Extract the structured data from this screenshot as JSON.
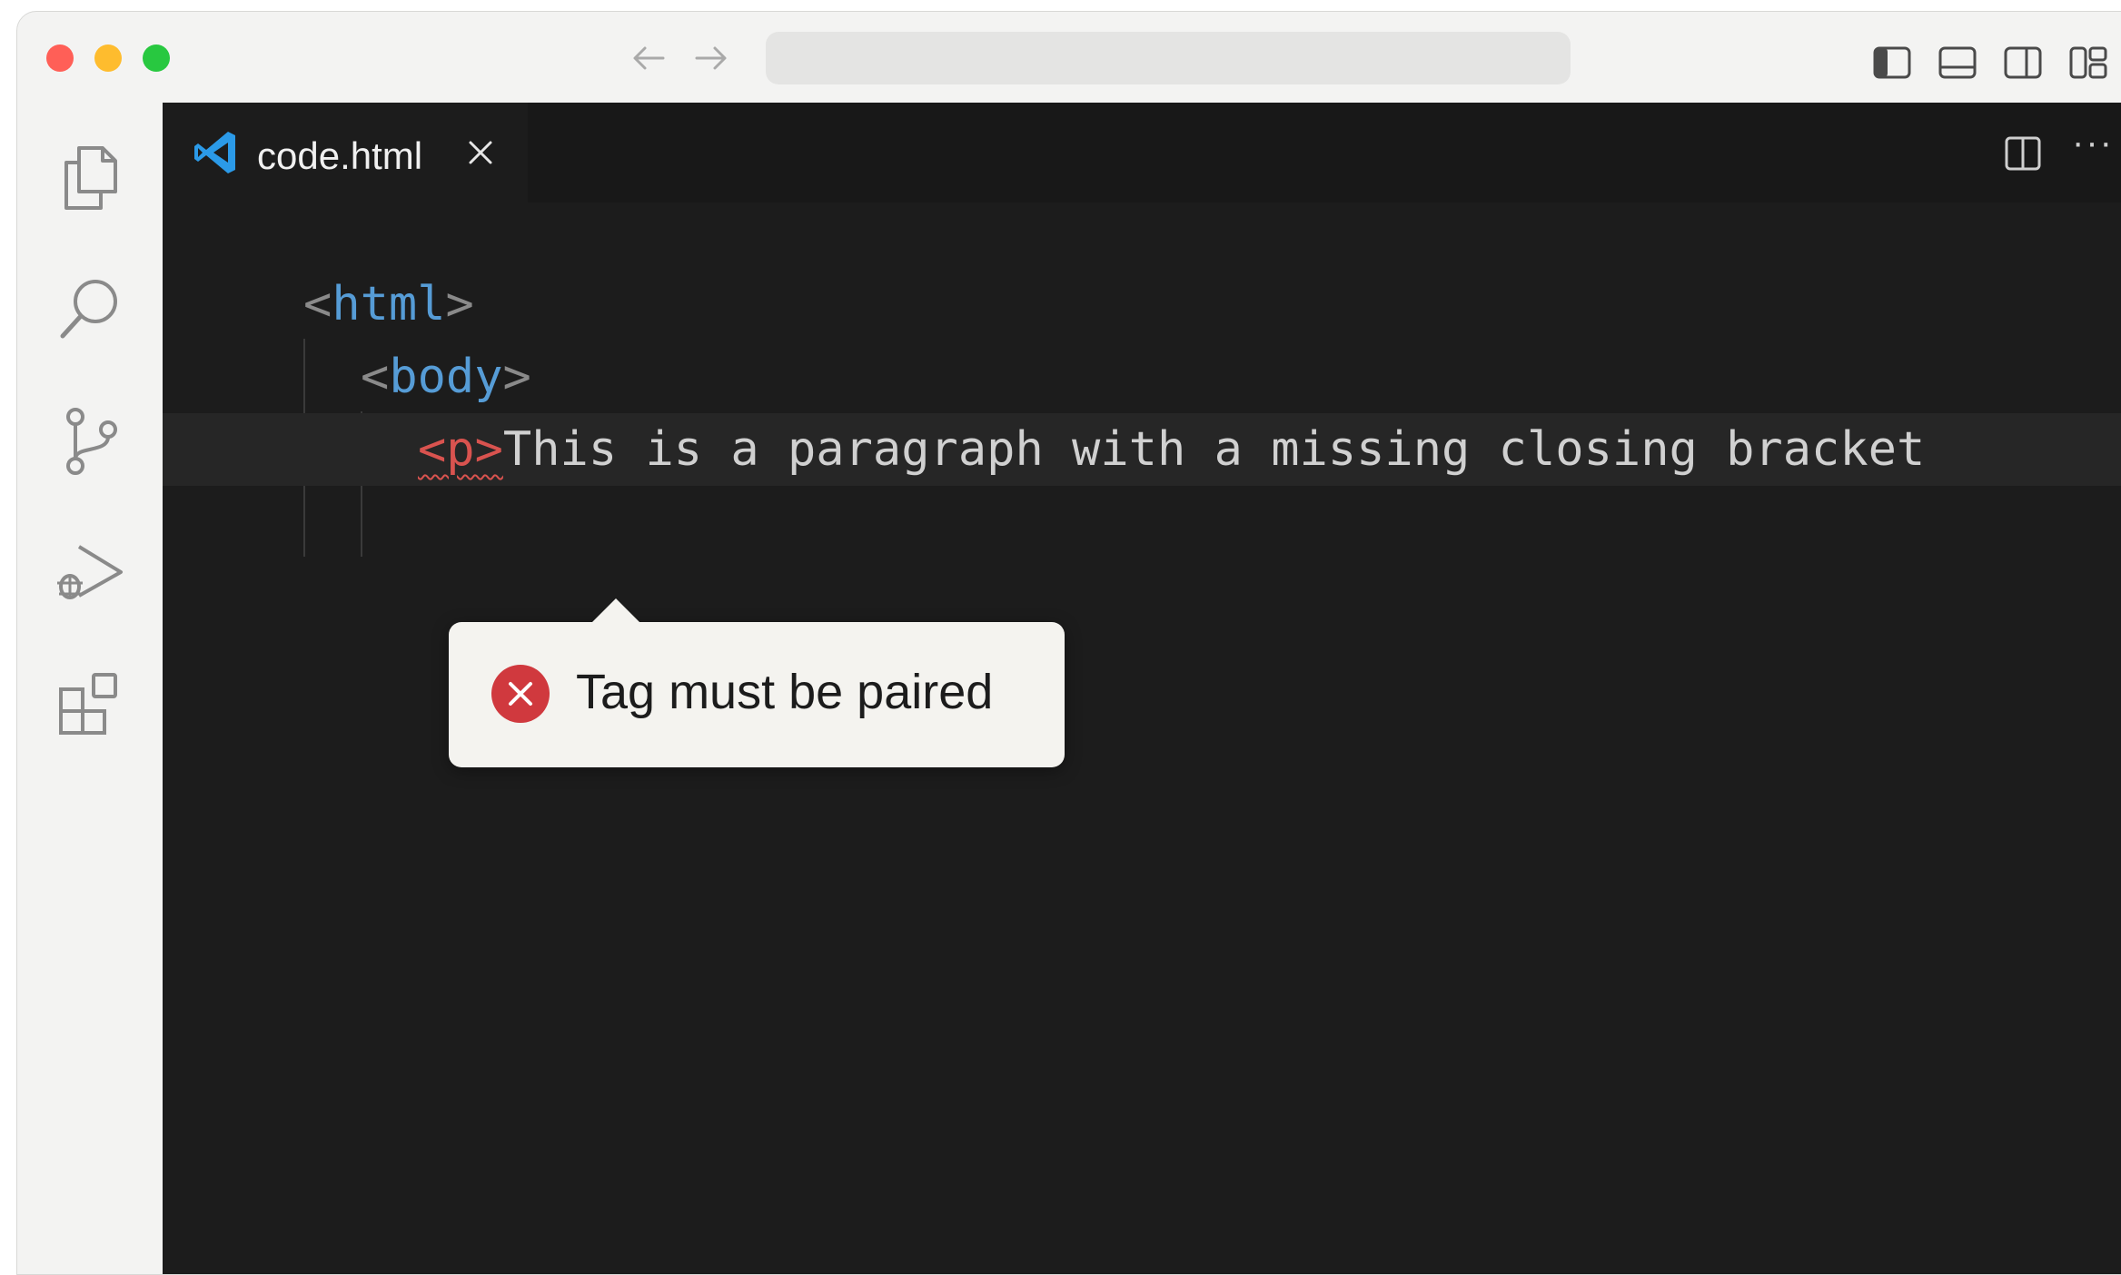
{
  "window": {
    "traffic_lights": {
      "close": "#ff5f57",
      "minimize": "#febc2e",
      "maximize": "#28c840"
    },
    "nav": {
      "back_icon": "arrow-left-icon",
      "forward_icon": "arrow-right-icon"
    },
    "layout_icons": [
      "toggle-primary-sidebar-icon",
      "toggle-panel-icon",
      "toggle-secondary-sidebar-icon",
      "customize-layout-icon"
    ]
  },
  "activity_bar": {
    "items": [
      "explorer-icon",
      "search-icon",
      "source-control-icon",
      "run-debug-icon",
      "extensions-icon"
    ]
  },
  "editor": {
    "tab": {
      "label": "code.html",
      "icon": "vscode-logo-icon",
      "close_icon": "close-icon"
    },
    "actions": {
      "split_icon": "split-editor-icon",
      "more": "···"
    },
    "lines": {
      "l1": {
        "open": "<",
        "tag": "html",
        "close": ">"
      },
      "l2": {
        "open": "<",
        "tag": "body",
        "close": ">"
      },
      "l3": {
        "tag_error": "<p>",
        "text": "This is a paragraph with a missing closing bracket"
      }
    },
    "accent_error": "#d9534f"
  },
  "hover": {
    "icon": "error-icon",
    "message": "Tag must be paired"
  }
}
